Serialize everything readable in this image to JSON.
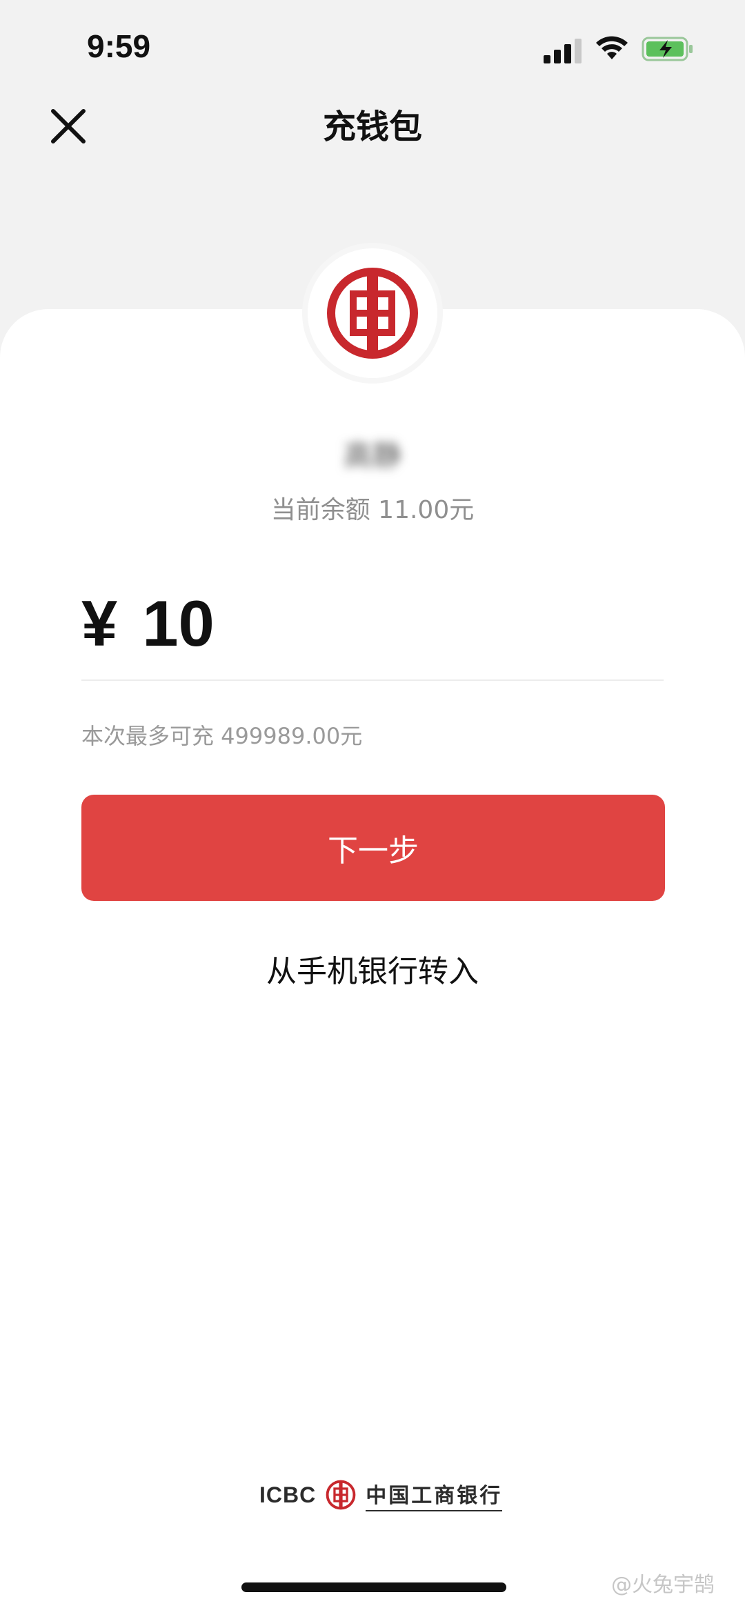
{
  "status_bar": {
    "time": "9:59"
  },
  "nav": {
    "title": "充钱包"
  },
  "account": {
    "name": "高静",
    "balance_text": "当前余额 11.00元"
  },
  "amount": {
    "currency_symbol": "¥",
    "value": "10"
  },
  "limit": {
    "text": "本次最多可充 499989.00元"
  },
  "actions": {
    "next_label": "下一步",
    "transfer_label": "从手机银行转入"
  },
  "footer": {
    "brand_abbr": "ICBC",
    "bank_name": "中国工商银行"
  },
  "watermark": {
    "text": "@火兔宇鹄"
  },
  "colors": {
    "accent": "#e04442",
    "logo_red": "#c8282d",
    "header_bg": "#f2f2f2"
  }
}
